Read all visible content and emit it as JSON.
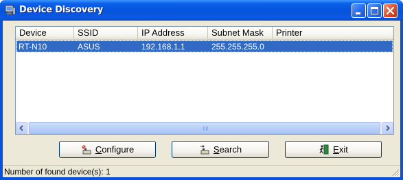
{
  "window": {
    "title": "Device Discovery",
    "icon": "computer-icon",
    "controls": [
      "minimize-icon",
      "maximize-icon",
      "close-icon"
    ]
  },
  "list": {
    "columns": [
      "Device",
      "SSID",
      "IP Address",
      "Subnet Mask",
      "Printer"
    ],
    "rows": [
      {
        "device": "RT-N10",
        "ssid": "ASUS",
        "ip": "192.168.1.1",
        "subnet": "255.255.255.0",
        "printer": ""
      }
    ],
    "selected_row": 0
  },
  "buttons": {
    "configure": {
      "mnemonic": "C",
      "rest": "onfigure",
      "icon": "configure-icon"
    },
    "search": {
      "mnemonic": "S",
      "rest": "earch",
      "icon": "search-icon"
    },
    "exit": {
      "mnemonic": "E",
      "rest": "xit",
      "icon": "exit-icon"
    }
  },
  "status": {
    "text": "Number of found device(s): 1"
  },
  "colors": {
    "titlebar": "#0653dd",
    "selection": "#316ac5",
    "face": "#ece9d8",
    "close": "#e0522d"
  }
}
